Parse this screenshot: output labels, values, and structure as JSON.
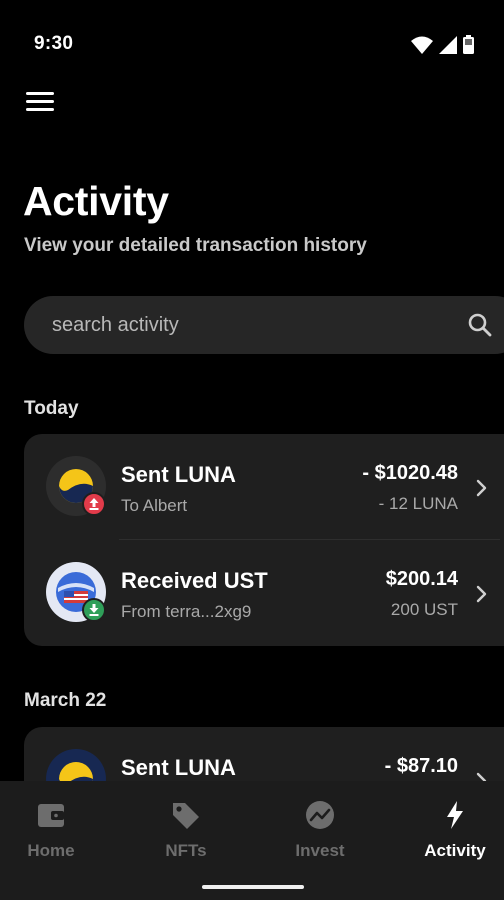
{
  "status_bar": {
    "time": "9:30",
    "icons": [
      "wifi-icon",
      "signal-icon",
      "battery-icon"
    ]
  },
  "header": {
    "menu_icon": "hamburger-menu-icon",
    "title": "Activity",
    "subtitle": "View your detailed transaction history"
  },
  "search": {
    "placeholder": "search activity",
    "value": "",
    "icon": "search-icon"
  },
  "sections": [
    {
      "label": "Today",
      "transactions": [
        {
          "title": "Sent LUNA",
          "subtitle": "To Albert",
          "amount": "- $1020.48",
          "quantity": "- 12 LUNA",
          "token": "LUNA",
          "direction": "sent"
        },
        {
          "title": "Received UST",
          "subtitle": "From terra...2xg9",
          "amount": "$200.14",
          "quantity": "200 UST",
          "token": "UST",
          "direction": "received"
        }
      ]
    },
    {
      "label": "March 22",
      "transactions": [
        {
          "title": "Sent LUNA",
          "subtitle": "",
          "amount": "- $87.10",
          "quantity": "",
          "token": "LUNA",
          "direction": "sent"
        }
      ]
    }
  ],
  "bottom_nav": {
    "items": [
      {
        "label": "Home",
        "icon": "wallet-icon",
        "active": false
      },
      {
        "label": "NFTs",
        "icon": "tag-icon",
        "active": false
      },
      {
        "label": "Invest",
        "icon": "chart-icon",
        "active": false
      },
      {
        "label": "Activity",
        "icon": "lightning-icon",
        "active": true
      }
    ]
  },
  "colors": {
    "background": "#000000",
    "card": "#1f1f1f",
    "sent_badge": "#e23b4a",
    "received_badge": "#2f9f59",
    "luna_yellow": "#f5c518",
    "luna_navy": "#172852"
  }
}
